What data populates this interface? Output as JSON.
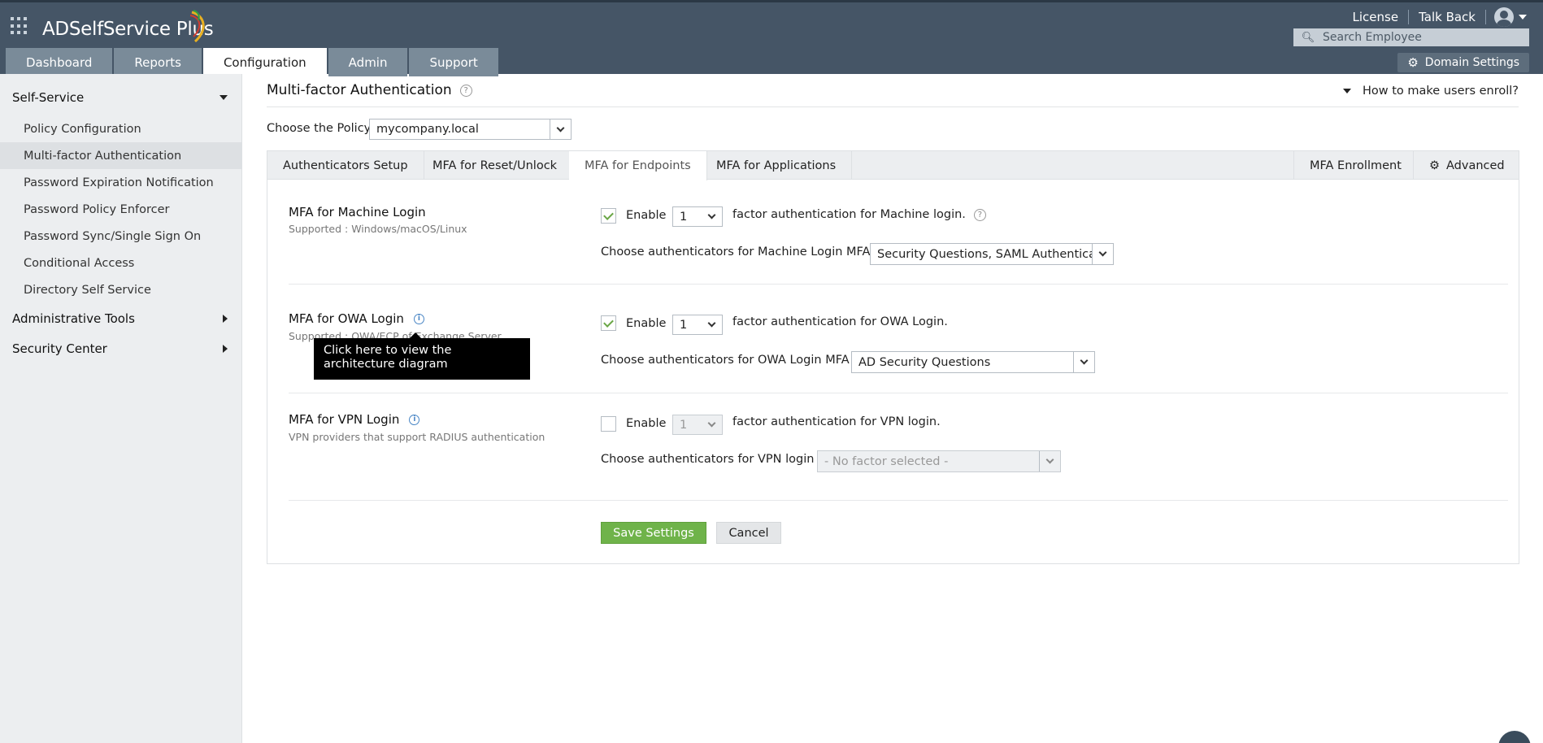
{
  "app": {
    "title": "ADSelfService Plus",
    "top_links": [
      "License",
      "Talk Back"
    ],
    "search_placeholder": "Search Employee",
    "domain_settings": "Domain Settings"
  },
  "nav": {
    "tabs": [
      {
        "label": "Dashboard",
        "active": false
      },
      {
        "label": "Reports",
        "active": false
      },
      {
        "label": "Configuration",
        "active": true
      },
      {
        "label": "Admin",
        "active": false
      },
      {
        "label": "Support",
        "active": false
      }
    ]
  },
  "sidebar": {
    "self_service": "Self-Service",
    "items": [
      {
        "label": "Policy Configuration",
        "active": false
      },
      {
        "label": "Multi-factor Authentication",
        "active": true
      },
      {
        "label": "Password Expiration Notification",
        "active": false
      },
      {
        "label": "Password Policy Enforcer",
        "active": false
      },
      {
        "label": "Password Sync/Single Sign On",
        "active": false
      },
      {
        "label": "Conditional Access",
        "active": false
      },
      {
        "label": "Directory Self Service",
        "active": false
      }
    ],
    "administrative_tools": "Administrative Tools",
    "security_center": "Security Center"
  },
  "main": {
    "title": "Multi-factor Authentication",
    "help_link": "How to make users enroll?",
    "policy_label": "Choose the Policy",
    "policy_value": "mycompany.local",
    "tabs": {
      "authenticators_setup": "Authenticators Setup",
      "mfa_reset_unlock": "MFA for Reset/Unlock",
      "mfa_endpoints": "MFA for Endpoints",
      "mfa_applications": "MFA for Applications",
      "mfa_enrollment": "MFA Enrollment",
      "advanced": "Advanced"
    },
    "machine": {
      "title": "MFA for Machine Login",
      "subtitle": "Supported : Windows/macOS/Linux",
      "enable_label": "Enable",
      "enabled": true,
      "factor_count": "1",
      "factor_text": "factor authentication for Machine login.",
      "choose_label": "Choose authenticators for Machine Login MFA",
      "authenticators": "Security Questions, SAML Authenticator"
    },
    "owa": {
      "title": "MFA for OWA Login",
      "subtitle": "Supported : OWA/ECP of Exchange Server",
      "enable_label": "Enable",
      "enabled": true,
      "factor_count": "1",
      "factor_text": "factor authentication for OWA Login.",
      "choose_label": "Choose authenticators for OWA Login MFA",
      "authenticators": "AD Security Questions",
      "tooltip": "Click here to view the architecture diagram"
    },
    "vpn": {
      "title": "MFA for VPN Login",
      "subtitle": "VPN providers that support RADIUS authentication",
      "enable_label": "Enable",
      "enabled": false,
      "factor_count": "1",
      "factor_text": "factor authentication for VPN login.",
      "choose_label": "Choose authenticators for VPN login",
      "authenticators": "- No factor selected -"
    },
    "save_label": "Save Settings",
    "cancel_label": "Cancel"
  },
  "colors": {
    "header_bg": "#455566",
    "save_green": "#6fb34a",
    "info_blue": "#4a86c5"
  }
}
